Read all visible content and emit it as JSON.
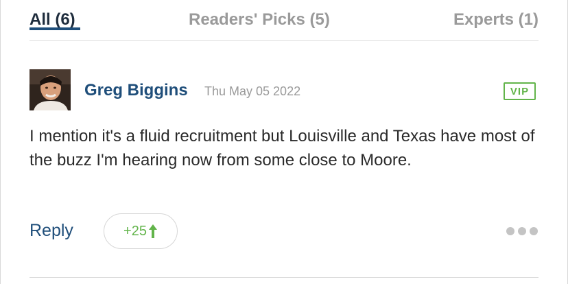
{
  "tabs": {
    "all": "All (6)",
    "readers_picks": "Readers' Picks (5)",
    "experts": "Experts (1)",
    "active": "all"
  },
  "comment": {
    "author": "Greg Biggins",
    "date": "Thu May 05 2022",
    "badge": "VIP",
    "text": "I mention it's a fluid recruitment but Louisville and Texas have most of the buzz I'm hearing now from some close to Moore.",
    "avatar_icon": "user-photo-icon"
  },
  "actions": {
    "reply_label": "Reply",
    "vote_count": "+25",
    "vote_icon": "arrow-up-icon",
    "more_icon": "more-dots-icon"
  },
  "colors": {
    "link_blue": "#1f4e7a",
    "vip_green": "#62b44a",
    "muted_gray": "#9a9a9a"
  }
}
